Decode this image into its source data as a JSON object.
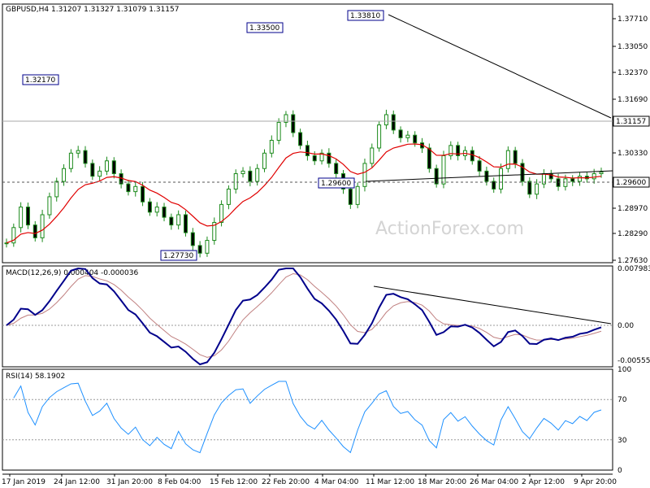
{
  "header": {
    "symbol_tf": "GBPUSD,H4",
    "ohlc": "1.31207 1.31327 1.31079 1.31157"
  },
  "watermark": "ActionForex.com",
  "colors": {
    "candle": "#1b8a1b",
    "ma": "#e00000",
    "macd": "#00008b",
    "signal": "#c08080",
    "rsi": "#1e90ff",
    "trendline": "#000000",
    "label_border": "#00008b",
    "grid_dash": "#999999"
  },
  "chart_data": [
    {
      "type": "candlestick",
      "panel": "price",
      "ylim": [
        1.2763,
        1.3771
      ],
      "yticks": [
        "1.37710",
        "1.36700",
        "1.35690",
        "1.34680",
        "1.33670",
        "1.32630",
        "1.31620",
        "1.30610",
        "1.29590",
        "1.28580",
        "1.27630"
      ],
      "ytick_labels": [
        "1.37710",
        "1.33050",
        "1.32370",
        "1.31690",
        "1.30330",
        "1.29650",
        "1.28970",
        "1.28290",
        "1.27630"
      ],
      "current_price": "1.31157",
      "support_level": "1.29600",
      "labels": [
        "1.32170",
        "1.33500",
        "1.33810",
        "1.29600",
        "1.27730"
      ],
      "close": [
        1.284,
        1.29,
        1.298,
        1.291,
        1.286,
        1.295,
        1.302,
        1.308,
        1.313,
        1.319,
        1.32,
        1.315,
        1.31,
        1.312,
        1.316,
        1.311,
        1.307,
        1.304,
        1.306,
        1.3,
        1.296,
        1.298,
        1.294,
        1.291,
        1.295,
        1.288,
        1.283,
        1.28,
        1.285,
        1.292,
        1.299,
        1.305,
        1.311,
        1.312,
        1.308,
        1.313,
        1.319,
        1.324,
        1.331,
        1.334,
        1.327,
        1.322,
        1.318,
        1.316,
        1.319,
        1.315,
        1.311,
        1.305,
        1.299,
        1.306,
        1.315,
        1.321,
        1.33,
        1.334,
        1.328,
        1.325,
        1.326,
        1.323,
        1.321,
        1.313,
        1.307,
        1.318,
        1.322,
        1.318,
        1.32,
        1.316,
        1.312,
        1.308,
        1.305,
        1.313,
        1.32,
        1.315,
        1.308,
        1.303,
        1.307,
        1.311,
        1.309,
        1.306,
        1.309,
        1.308,
        1.31,
        1.309,
        1.311,
        1.3116
      ]
    },
    {
      "type": "line",
      "panel": "macd",
      "title": "MACD(12,26,9) 0.000404 -0.000036",
      "yticks": [
        "0.007983",
        "0.00",
        "-0.005559"
      ],
      "ylim": [
        -0.0065,
        0.0085
      ]
    },
    {
      "type": "line",
      "panel": "rsi",
      "title": "RSI(14) 58.1902",
      "yticks": [
        "100",
        "70",
        "30",
        "0"
      ],
      "ylim": [
        0,
        100
      ]
    }
  ],
  "xaxis": {
    "labels": [
      "17 Jan 2019",
      "24 Jan 12:00",
      "31 Jan 20:00",
      "8 Feb 04:00",
      "15 Feb 12:00",
      "22 Feb 20:00",
      "4 Mar 04:00",
      "11 Mar 12:00",
      "18 Mar 20:00",
      "26 Mar 04:00",
      "2 Apr 12:00",
      "9 Apr 20:00"
    ]
  }
}
